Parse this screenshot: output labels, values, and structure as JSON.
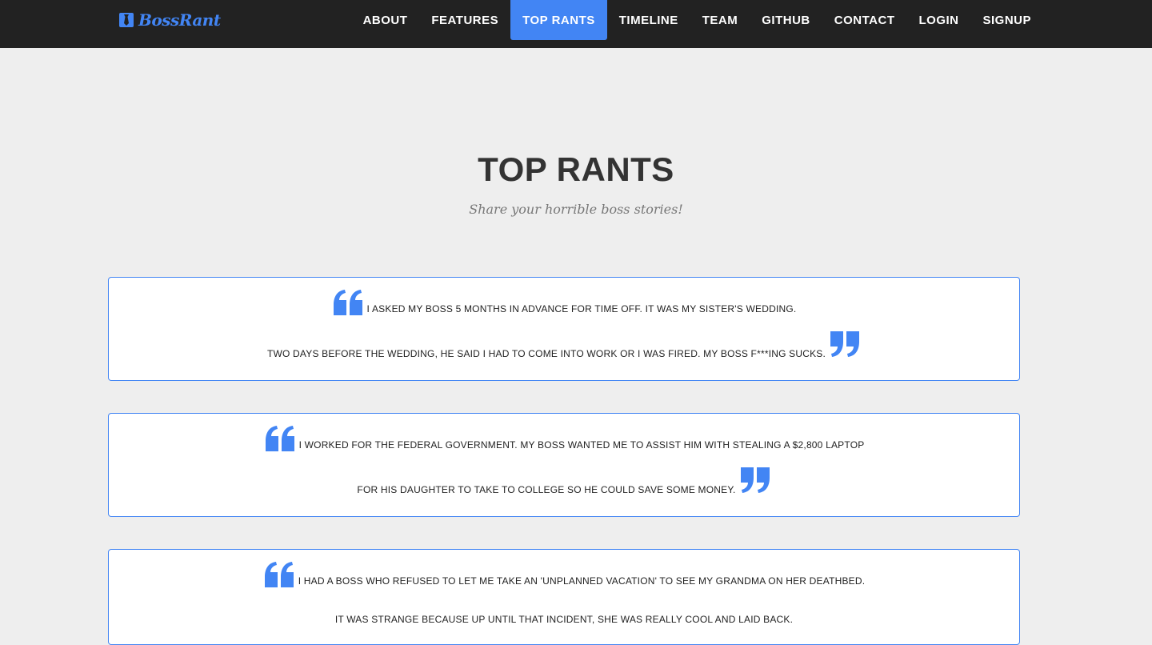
{
  "brand": {
    "name": "BossRant",
    "color": "#4285f4"
  },
  "nav": {
    "items": [
      {
        "label": "ABOUT",
        "active": false
      },
      {
        "label": "FEATURES",
        "active": false
      },
      {
        "label": "TOP RANTS",
        "active": true
      },
      {
        "label": "TIMELINE",
        "active": false
      },
      {
        "label": "TEAM",
        "active": false
      },
      {
        "label": "GITHUB",
        "active": false
      },
      {
        "label": "CONTACT",
        "active": false
      },
      {
        "label": "LOGIN",
        "active": false
      },
      {
        "label": "SIGNUP",
        "active": false
      }
    ]
  },
  "section": {
    "title": "TOP RANTS",
    "subtitle": "Share your horrible boss stories!"
  },
  "rants": [
    {
      "line1": "I ASKED MY BOSS 5 MONTHS IN ADVANCE FOR TIME OFF. IT WAS MY SISTER'S WEDDING.",
      "line2": "TWO DAYS BEFORE THE WEDDING, HE SAID I HAD TO COME INTO WORK OR I WAS FIRED. MY BOSS F***ING SUCKS."
    },
    {
      "line1": "I WORKED FOR THE FEDERAL GOVERNMENT. MY BOSS WANTED ME TO ASSIST HIM WITH STEALING A $2,800 LAPTOP",
      "line2": "FOR HIS DAUGHTER TO TAKE TO COLLEGE SO HE COULD SAVE SOME MONEY."
    },
    {
      "line1": "I HAD A BOSS WHO REFUSED TO LET ME TAKE AN 'UNPLANNED VACATION' TO SEE MY GRANDMA ON HER DEATHBED.",
      "line2": "IT WAS STRANGE BECAUSE UP UNTIL THAT INCIDENT, SHE WAS REALLY COOL AND LAID BACK."
    }
  ],
  "colors": {
    "accent": "#4285f4",
    "navbar": "#222222",
    "background": "#eeeeee"
  },
  "icons": {
    "open_quote": "quote-open-icon",
    "close_quote": "quote-close-icon",
    "brand": "tie-icon"
  }
}
